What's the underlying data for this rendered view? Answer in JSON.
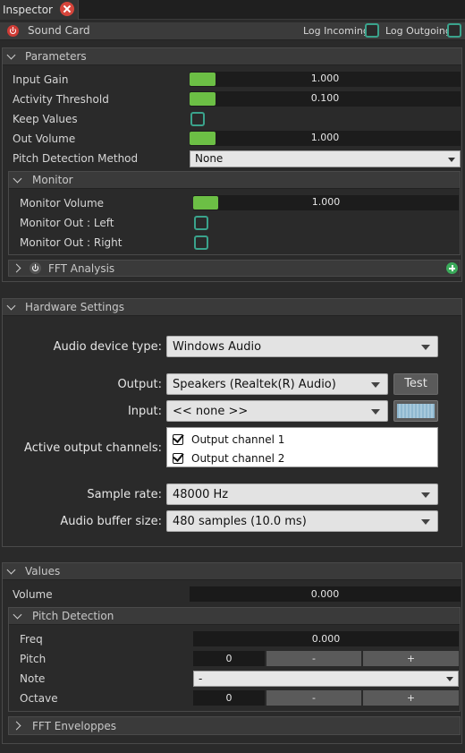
{
  "tab": {
    "title": "Inspector"
  },
  "titlebar": {
    "name": "Sound Card",
    "log_incoming": "Log Incoming",
    "log_outgoing": "Log Outgoing"
  },
  "parameters": {
    "title": "Parameters",
    "input_gain": {
      "label": "Input Gain",
      "value": "1.000",
      "fill": 0.12
    },
    "activity_threshold": {
      "label": "Activity Threshold",
      "value": "0.100",
      "fill": 0.12
    },
    "keep_values": {
      "label": "Keep Values"
    },
    "out_volume": {
      "label": "Out Volume",
      "value": "1.000",
      "fill": 0.12
    },
    "pitch_method": {
      "label": "Pitch Detection Method",
      "value": "None"
    },
    "monitor": {
      "title": "Monitor",
      "volume": {
        "label": "Monitor Volume",
        "value": "1.000",
        "fill": 0.12
      },
      "out_left": {
        "label": "Monitor Out : Left"
      },
      "out_right": {
        "label": "Monitor Out : Right"
      }
    },
    "fft": {
      "title": "FFT Analysis"
    }
  },
  "hardware": {
    "title": "Hardware Settings",
    "device_type_label": "Audio device type:",
    "device_type": "Windows Audio",
    "output_label": "Output:",
    "output": "Speakers (Realtek(R) Audio)",
    "test": "Test",
    "input_label": "Input:",
    "input": "<< none >>",
    "channels_label": "Active output channels:",
    "channels": [
      "Output channel 1",
      "Output channel 2"
    ],
    "sample_rate_label": "Sample rate:",
    "sample_rate": "48000 Hz",
    "buffer_label": "Audio buffer size:",
    "buffer": "480 samples (10.0 ms)"
  },
  "values": {
    "title": "Values",
    "volume": {
      "label": "Volume",
      "value": "0.000"
    },
    "pitch": {
      "title": "Pitch Detection",
      "freq": {
        "label": "Freq",
        "value": "0.000"
      },
      "pitch": {
        "label": "Pitch",
        "value": "0"
      },
      "note": {
        "label": "Note",
        "value": "-"
      },
      "octave": {
        "label": "Octave",
        "value": "0"
      },
      "minus": "-",
      "plus": "+"
    },
    "fft_env": {
      "title": "FFT Enveloppes"
    }
  },
  "colors": {
    "accent_green": "#6cbf45",
    "checkbox_teal": "#3aa38c",
    "power_red": "#cf3b35"
  }
}
